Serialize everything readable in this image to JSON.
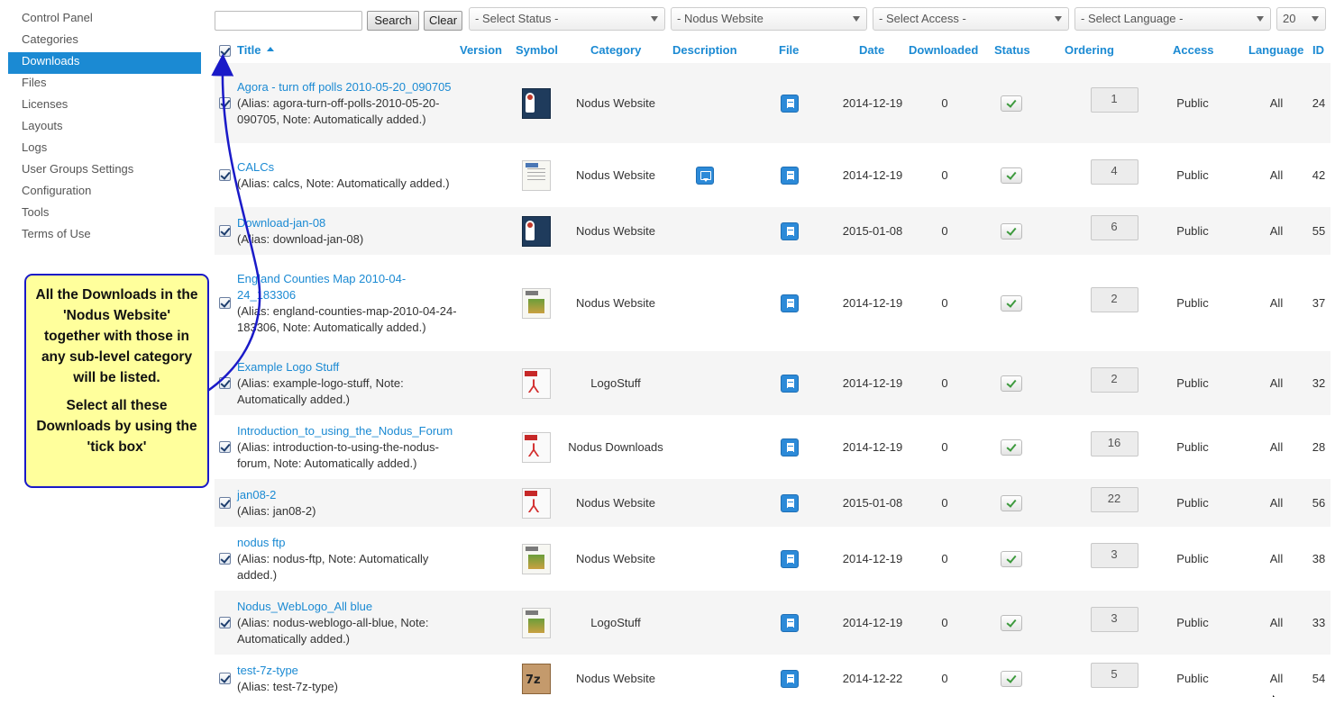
{
  "sidebar": {
    "items": [
      {
        "label": "Control Panel",
        "active": false
      },
      {
        "label": "Categories",
        "active": false
      },
      {
        "label": "Downloads",
        "active": true
      },
      {
        "label": "Files",
        "active": false
      },
      {
        "label": "Licenses",
        "active": false
      },
      {
        "label": "Layouts",
        "active": false
      },
      {
        "label": "Logs",
        "active": false
      },
      {
        "label": "User Groups Settings",
        "active": false
      },
      {
        "label": "Configuration",
        "active": false
      },
      {
        "label": "Tools",
        "active": false
      },
      {
        "label": "Terms of Use",
        "active": false
      }
    ]
  },
  "toolbar": {
    "search_value": "",
    "search_label": "Search",
    "clear_label": "Clear",
    "status_select": "- Select Status -",
    "category_select": "- Nodus Website",
    "access_select": "- Select Access -",
    "language_select": "- Select Language -",
    "limit_select": "20"
  },
  "table": {
    "headers": {
      "title": "Title",
      "version": "Version",
      "symbol": "Symbol",
      "category": "Category",
      "description": "Description",
      "file": "File",
      "date": "Date",
      "downloaded": "Downloaded",
      "status": "Status",
      "ordering": "Ordering",
      "access": "Access",
      "language": "Language",
      "id": "ID"
    },
    "rows": [
      {
        "title": "Agora - turn off polls 2010-05-20_090705",
        "alias": "(Alias: agora-turn-off-polls-2010-05-20-090705, Note: Automatically added.)",
        "symbol": "book-cover-icon",
        "category": "Nodus Website",
        "has_description": false,
        "date": "2014-12-19",
        "downloaded": "0",
        "ordering": "1",
        "access": "Public",
        "language": "All",
        "id": "24"
      },
      {
        "title": "CALCs",
        "alias": "(Alias: calcs, Note: Automatically added.)",
        "symbol": "word-document-icon",
        "category": "Nodus Website",
        "has_description": true,
        "date": "2014-12-19",
        "downloaded": "0",
        "ordering": "4",
        "access": "Public",
        "language": "All",
        "id": "42"
      },
      {
        "title": "Download-jan-08",
        "alias": "(Alias: download-jan-08)",
        "symbol": "book-cover-icon",
        "category": "Nodus Website",
        "has_description": false,
        "date": "2015-01-08",
        "downloaded": "0",
        "ordering": "6",
        "access": "Public",
        "language": "All",
        "id": "55"
      },
      {
        "title": "England Counties Map 2010-04-24_183306",
        "alias": "(Alias: england-counties-map-2010-04-24-183306, Note: Automatically added.)",
        "symbol": "png-image-icon",
        "category": "Nodus Website",
        "has_description": false,
        "date": "2014-12-19",
        "downloaded": "0",
        "ordering": "2",
        "access": "Public",
        "language": "All",
        "id": "37"
      },
      {
        "title": "Example Logo Stuff",
        "alias": "(Alias: example-logo-stuff, Note: Automatically added.)",
        "symbol": "pdf-icon",
        "category": "LogoStuff",
        "has_description": false,
        "date": "2014-12-19",
        "downloaded": "0",
        "ordering": "2",
        "access": "Public",
        "language": "All",
        "id": "32"
      },
      {
        "title": "Introduction_to_using_the_Nodus_Forum",
        "alias": "(Alias: introduction-to-using-the-nodus-forum, Note: Automatically added.)",
        "symbol": "pdf-icon",
        "category": "Nodus Downloads",
        "has_description": false,
        "date": "2014-12-19",
        "downloaded": "0",
        "ordering": "16",
        "access": "Public",
        "language": "All",
        "id": "28"
      },
      {
        "title": "jan08-2",
        "alias": "(Alias: jan08-2)",
        "symbol": "pdf-icon",
        "category": "Nodus Website",
        "has_description": false,
        "date": "2015-01-08",
        "downloaded": "0",
        "ordering": "22",
        "access": "Public",
        "language": "All",
        "id": "56"
      },
      {
        "title": "nodus ftp",
        "alias": "(Alias: nodus-ftp, Note: Automatically added.)",
        "symbol": "png-image-icon",
        "category": "Nodus Website",
        "has_description": false,
        "date": "2014-12-19",
        "downloaded": "0",
        "ordering": "3",
        "access": "Public",
        "language": "All",
        "id": "38"
      },
      {
        "title": "Nodus_WebLogo_All blue",
        "alias": "(Alias: nodus-weblogo-all-blue, Note: Automatically added.)",
        "symbol": "png-image-icon",
        "category": "LogoStuff",
        "has_description": false,
        "date": "2014-12-19",
        "downloaded": "0",
        "ordering": "3",
        "access": "Public",
        "language": "All",
        "id": "33"
      },
      {
        "title": "test-7z-type",
        "alias": "(Alias: test-7z-type)",
        "symbol": "7z-archive-icon",
        "category": "Nodus Website",
        "has_description": false,
        "date": "2014-12-22",
        "downloaded": "0",
        "ordering": "5",
        "access": "Public",
        "language": "All",
        "id": "54"
      }
    ]
  },
  "callout": {
    "paragraph1": "All the Downloads in the 'Nodus Website' together with those in any sub-level category will be listed.",
    "paragraph2": "Select all these Downloads by using the 'tick box'"
  },
  "colors": {
    "accent": "#1b8ad3",
    "callout_bg": "#ffff9c",
    "callout_border": "#1a1ac8"
  }
}
